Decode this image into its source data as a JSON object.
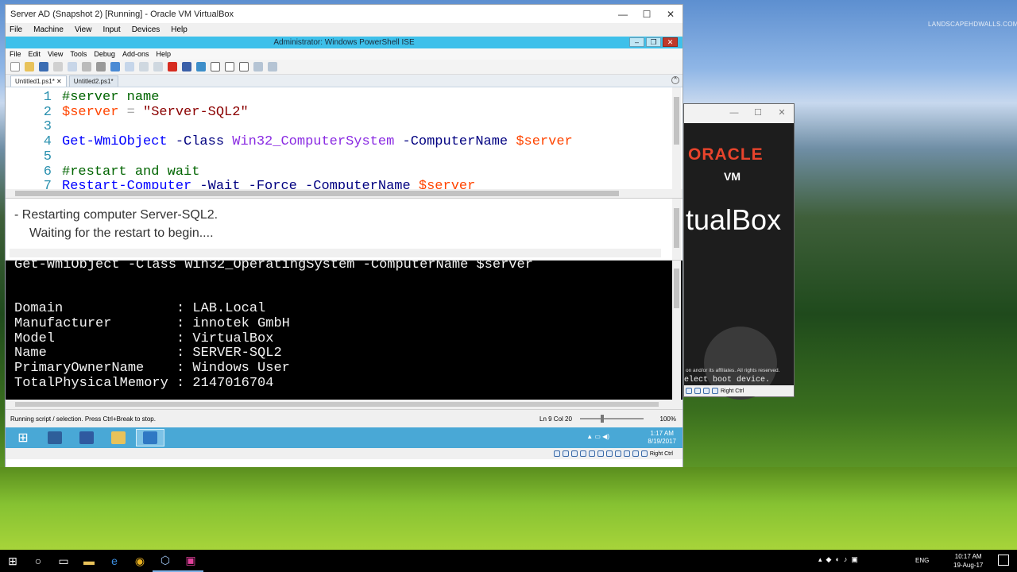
{
  "watermark": "LANDSCAPEHDWALLS.COM",
  "vbox": {
    "title": "Server AD (Snapshot 2) [Running] - Oracle VM VirtualBox",
    "menu": [
      "File",
      "Machine",
      "View",
      "Input",
      "Devices",
      "Help"
    ],
    "status_host_key": "Right Ctrl"
  },
  "ise": {
    "title": "Administrator: Windows PowerShell ISE",
    "menu": [
      "File",
      "Edit",
      "View",
      "Tools",
      "Debug",
      "Add-ons",
      "Help"
    ],
    "tabs": [
      "Untitled1.ps1*",
      "Untitled2.ps1*"
    ],
    "line_numbers": [
      "1",
      "2",
      "3",
      "4",
      "5",
      "6",
      "7"
    ],
    "code": {
      "l1": "#server name",
      "l2_var": "$server",
      "l2_op": " = ",
      "l2_str": "\"Server-SQL2\"",
      "l4_cmd": "Get-WmiObject",
      "l4_p1": " -Class ",
      "l4_type": "Win32_ComputerSystem",
      "l4_p2": " -ComputerName ",
      "l4_var": "$server",
      "l6": "#restart and wait",
      "l7_cmd": "Restart-Computer",
      "l7_p": " -Wait -Force -ComputerName ",
      "l7_var": "$server"
    },
    "output": {
      "line1": "- Restarting computer Server-SQL2.",
      "line2": "Waiting for the restart to begin...."
    },
    "console": {
      "command": "Get-WmiObject -Class Win32_OperatingSystem -ComputerName $server",
      "rows": [
        "Domain              : LAB.Local",
        "Manufacturer        : innotek GmbH",
        "Model               : VirtualBox",
        "Name                : SERVER-SQL2",
        "PrimaryOwnerName    : Windows User",
        "TotalPhysicalMemory : 2147016704"
      ]
    },
    "status": {
      "message": "Running script / selection.  Press Ctrl+Break to stop.",
      "position": "Ln 9  Col 20",
      "zoom": "100%"
    }
  },
  "guest_taskbar": {
    "time": "1:17 AM",
    "date": "8/19/2017"
  },
  "splash": {
    "oracle": "ORACLE",
    "vm": "VM",
    "vbox": "tualBox",
    "copyright": "on and/or its affiliates. All rights reserved.",
    "boot": "elect boot device.",
    "host_key": "Right Ctrl"
  },
  "host_taskbar": {
    "lang": "ENG",
    "time": "10:17 AM",
    "date": "19-Aug-17"
  },
  "colors": {
    "ise_title": "#3ec0ea",
    "oracle_red": "#e8442c",
    "guest_taskbar": "#49a8d6"
  }
}
